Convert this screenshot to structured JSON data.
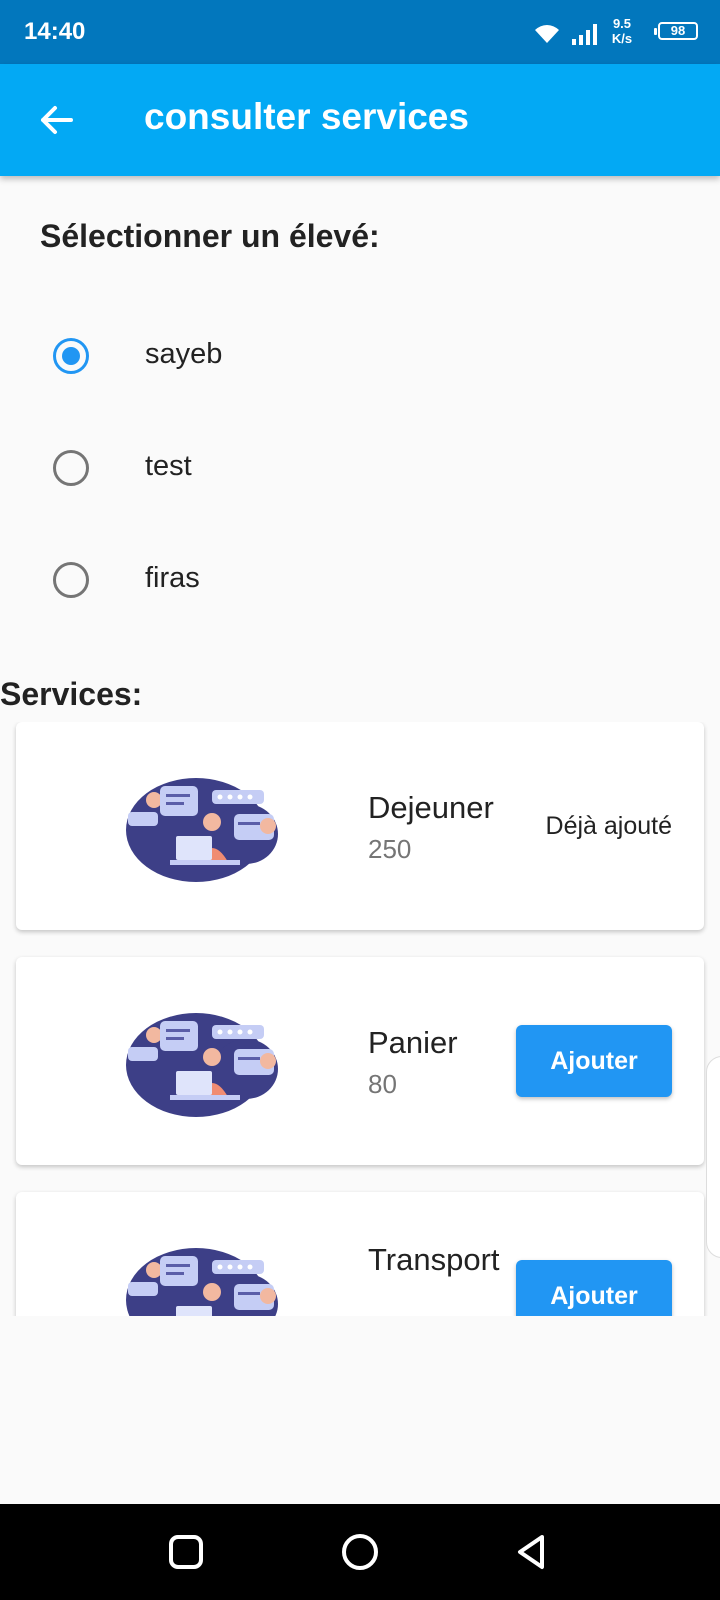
{
  "status_bar": {
    "time": "14:40",
    "speed": "9.5 K/s",
    "battery": "98"
  },
  "app_bar": {
    "title": "consulter services"
  },
  "student_select": {
    "title": "Sélectionner un élevé:",
    "options": [
      {
        "label": "sayeb",
        "selected": true
      },
      {
        "label": "test",
        "selected": false
      },
      {
        "label": "firas",
        "selected": false
      }
    ]
  },
  "services": {
    "title": "Services:",
    "items": [
      {
        "name": "Dejeuner",
        "price": "250",
        "status_label": "Déjà ajouté"
      },
      {
        "name": "Panier",
        "price": "80",
        "action_label": "Ajouter"
      },
      {
        "name": "Transport",
        "price": "",
        "action_label": "Ajouter"
      }
    ]
  },
  "colors": {
    "status_bar": "#0277bd",
    "app_bar": "#03a9f4",
    "accent": "#2196f3",
    "illustration_blob": "#3d3f87"
  },
  "icons": {
    "back": "arrow-left-icon",
    "wifi": "wifi-icon",
    "signal": "signal-icon",
    "battery": "battery-icon",
    "nav_recents": "square-icon",
    "nav_home": "circle-icon",
    "nav_back": "triangle-back-icon"
  }
}
